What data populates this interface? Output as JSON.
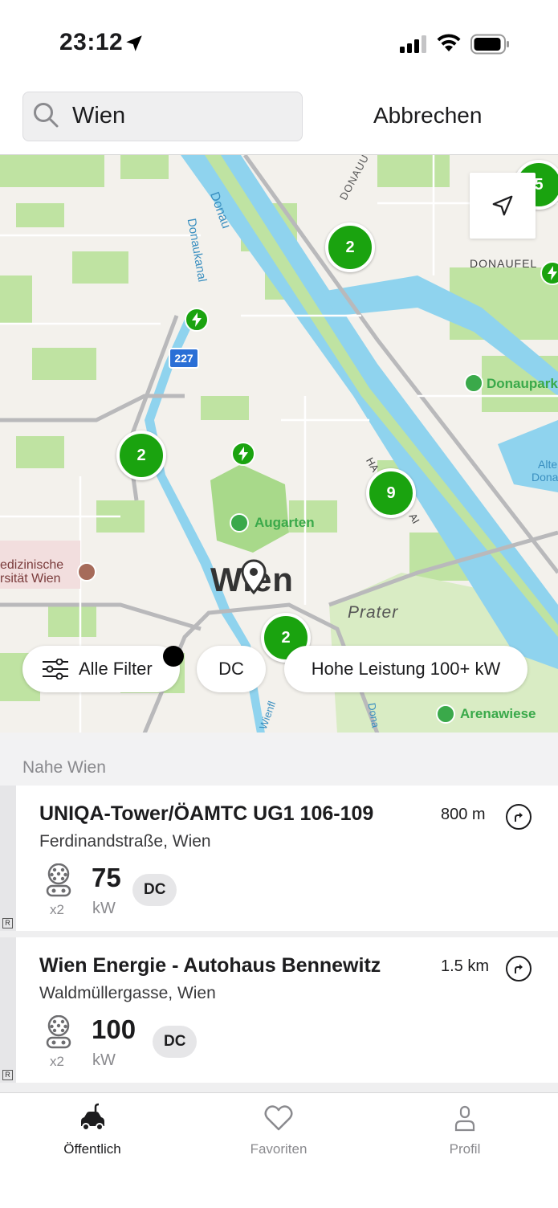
{
  "status_bar": {
    "time": "23:12"
  },
  "search": {
    "value": "Wien",
    "cancel_label": "Abbrechen"
  },
  "map": {
    "labels": {
      "city": "Wien",
      "prater": "Prater",
      "augarten": "Augarten",
      "donaupark": "Donaupark",
      "arenawiese": "Arenawiese",
      "donau": "Donau",
      "donaukanal": "Donaukanal",
      "donauufer": "DONAUU",
      "donaufeld": "DONAUFEL",
      "alte_donau": "Alte",
      "alte_donau2": "Dona",
      "hospital_1": "edizinische",
      "hospital_2": "rsität Wien",
      "route_227": "227",
      "handelskai": "HA",
      "handelskai2": "AI",
      "wienfluss": "Wienfl",
      "donau_lower": "Dona"
    },
    "clusters": [
      {
        "count": "2",
        "name": "cluster-north"
      },
      {
        "count": "2",
        "name": "cluster-west"
      },
      {
        "count": "9",
        "name": "cluster-east"
      },
      {
        "count": "2",
        "name": "cluster-south"
      },
      {
        "count": "5",
        "name": "cluster-edge"
      }
    ],
    "filters": {
      "all_filters": "Alle Filter",
      "dc": "DC",
      "high_power": "Hohe Leistung 100+ kW"
    },
    "colors": {
      "cluster": "#1aa30f",
      "water": "#8fd3ee",
      "park": "#b9e19a",
      "land": "#f3f1ec"
    }
  },
  "list": {
    "section_title": "Nahe Wien",
    "items": [
      {
        "title": "UNIQA-Tower/ÖAMTC UG1 106-109",
        "address": "Ferdinandstraße, Wien",
        "distance": "800 m",
        "plug_count": "x2",
        "power": "75",
        "unit": "kW",
        "type": "DC",
        "badge": "R"
      },
      {
        "title": "Wien Energie - Autohaus Bennewitz",
        "address": "Waldmüllergasse, Wien",
        "distance": "1.5 km",
        "plug_count": "x2",
        "power": "100",
        "unit": "kW",
        "type": "DC",
        "badge": "R"
      }
    ]
  },
  "tabs": [
    {
      "label": "Öffentlich",
      "icon": "car-charging-icon",
      "active": true
    },
    {
      "label": "Favoriten",
      "icon": "heart-icon",
      "active": false
    },
    {
      "label": "Profil",
      "icon": "person-icon",
      "active": false
    }
  ]
}
